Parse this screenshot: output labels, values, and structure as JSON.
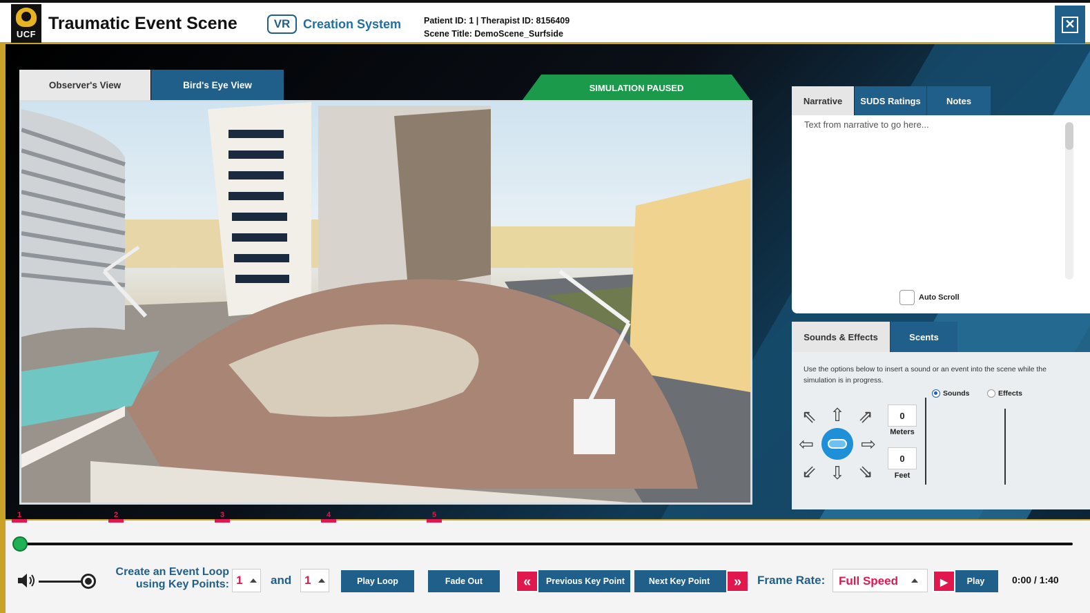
{
  "header": {
    "logo_text": "UCF",
    "title": "Traumatic Event Scene",
    "vr_badge": "VR",
    "subtitle": "Creation System",
    "patient_line": "Patient ID: 1 | Therapist ID: 8156409",
    "scene_line": "Scene Title: DemoScene_Surfside",
    "close_icon": "close-icon"
  },
  "view_tabs": {
    "observer": "Observer's View",
    "bird": "Bird's Eye View",
    "status": "SIMULATION PAUSED"
  },
  "narrative_panel": {
    "tabs": [
      "Narrative",
      "SUDS Ratings",
      "Notes"
    ],
    "text": "Text from narrative to go here...",
    "auto_scroll": "Auto Scroll"
  },
  "sounds_panel": {
    "tabs": [
      "Sounds & Effects",
      "Scents"
    ],
    "description": "Use the options below to insert a sound or an event into the scene while the simulation is in progress.",
    "radio_sounds": "Sounds",
    "radio_effects": "Effects",
    "meters_value": "0",
    "meters_label": "Meters",
    "feet_value": "0",
    "feet_label": "Feet"
  },
  "timeline": {
    "key_points": [
      "1",
      "2",
      "3",
      "4",
      "5"
    ],
    "progress": 0
  },
  "controls": {
    "loop_label_1": "Create an Event Loop",
    "loop_label_2": "using Key Points:",
    "loop_start": "1",
    "and": "and",
    "loop_end": "1",
    "play_loop": "Play Loop",
    "fade_out": "Fade Out",
    "prev_key": "Previous Key Point",
    "next_key": "Next Key Point",
    "frame_rate_label": "Frame Rate:",
    "frame_rate_value": "Full Speed",
    "play": "Play",
    "time": "0:00 / 1:40"
  },
  "colors": {
    "accent": "#1f5f8a",
    "keypoint": "#e0184e",
    "status_green": "#1a9a4a",
    "gold": "#c9a227"
  }
}
